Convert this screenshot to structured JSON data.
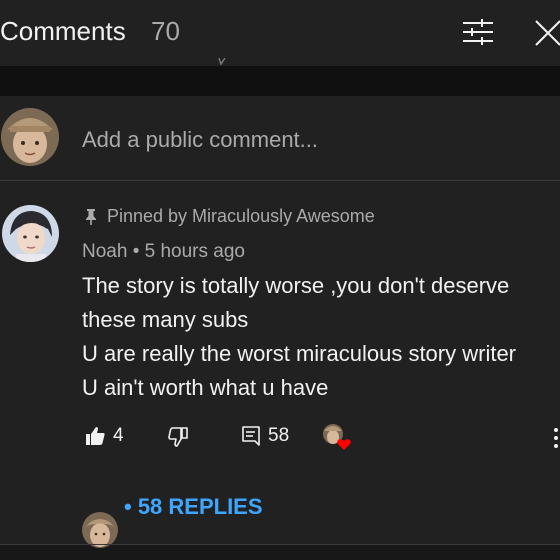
{
  "header": {
    "title": "Comments",
    "count": "70",
    "icons": [
      "sliders-icon",
      "close-icon"
    ]
  },
  "add_comment": {
    "placeholder": "Add a public comment..."
  },
  "comment": {
    "pinned_label": "Pinned by Miraculously Awesome",
    "author": "Noah",
    "separator": "•",
    "time": "5 hours ago",
    "lines": [
      "The story is totally worse ,you don't deserve",
      "these many subs",
      "U are really the worst miraculous story writer",
      "U ain't worth what u have"
    ],
    "likes": "4",
    "reply_count": "58",
    "replies_label": "• 58 REPLIES"
  },
  "colors": {
    "background": "#181818",
    "surface": "#212121",
    "text": "#f1f1f1",
    "muted": "#aaaaaa",
    "link": "#3ea6ff",
    "heart": "#ff0000"
  }
}
